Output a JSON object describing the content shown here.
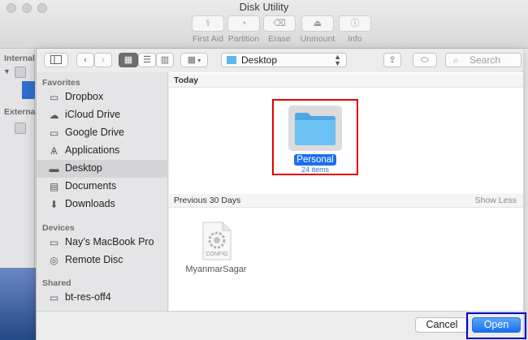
{
  "window": {
    "title": "Disk Utility",
    "toolbar": [
      {
        "label": "First Aid",
        "icon": "stethoscope-icon"
      },
      {
        "label": "Partition",
        "icon": "pie-icon"
      },
      {
        "label": "Erase",
        "icon": "erase-icon"
      },
      {
        "label": "Unmount",
        "icon": "eject-icon"
      },
      {
        "label": "Info",
        "icon": "info-icon"
      }
    ],
    "sidebar": {
      "internal": "Internal",
      "external": "External"
    }
  },
  "dialog": {
    "location": "Desktop",
    "search_placeholder": "Search",
    "sidebar": {
      "favorites_header": "Favorites",
      "favorites": [
        {
          "label": "Dropbox",
          "icon": "dropbox-folder-icon"
        },
        {
          "label": "iCloud Drive",
          "icon": "cloud-icon"
        },
        {
          "label": "Google Drive",
          "icon": "folder-icon"
        },
        {
          "label": "Applications",
          "icon": "applications-icon"
        },
        {
          "label": "Desktop",
          "icon": "desktop-icon",
          "selected": true
        },
        {
          "label": "Documents",
          "icon": "document-icon"
        },
        {
          "label": "Downloads",
          "icon": "download-icon"
        }
      ],
      "devices_header": "Devices",
      "devices": [
        {
          "label": "Nay’s MacBook Pro",
          "icon": "laptop-icon"
        },
        {
          "label": "Remote Disc",
          "icon": "disc-icon"
        }
      ],
      "shared_header": "Shared",
      "shared": [
        {
          "label": "bt-res-off4",
          "icon": "network-computer-icon"
        }
      ]
    },
    "content": {
      "today_header": "Today",
      "today_items": [
        {
          "name": "Personal",
          "subtitle": "24 items",
          "type": "folder",
          "selected": true
        }
      ],
      "previous_header": "Previous 30 Days",
      "show_less": "Show Less",
      "previous_items": [
        {
          "name": "MyanmarSagar",
          "badge": "CONFIG",
          "type": "config-file"
        }
      ]
    },
    "buttons": {
      "cancel": "Cancel",
      "open": "Open"
    }
  },
  "colors": {
    "accent": "#1b6ff0",
    "highlight_red": "#e00000",
    "highlight_blue": "#0000cc",
    "folder_blue": "#5fb5ef"
  }
}
